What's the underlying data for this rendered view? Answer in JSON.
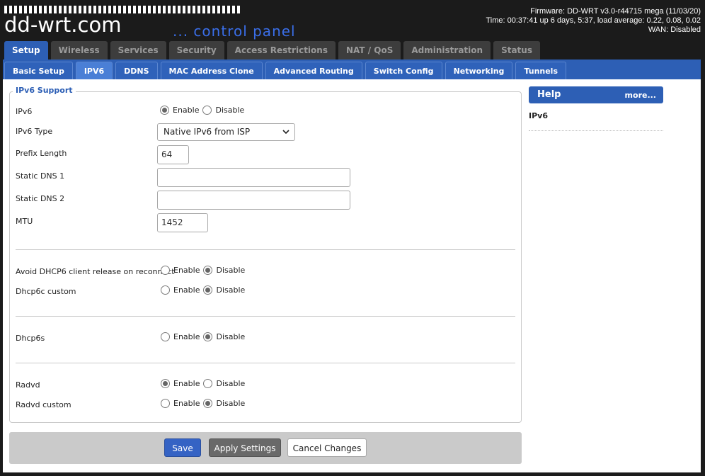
{
  "header": {
    "logo_text": "dd-wrt.com",
    "tagline": "... control panel",
    "firmware": "Firmware: DD-WRT v3.0-r44715 mega (11/03/20)",
    "time": "Time: 00:37:41 up 6 days, 5:37, load average: 0.22, 0.08, 0.02",
    "wan": "WAN: Disabled"
  },
  "main_tabs": [
    "Setup",
    "Wireless",
    "Services",
    "Security",
    "Access Restrictions",
    "NAT / QoS",
    "Administration",
    "Status"
  ],
  "sub_tabs": [
    "Basic Setup",
    "IPV6",
    "DDNS",
    "MAC Address Clone",
    "Advanced Routing",
    "Switch Config",
    "Networking",
    "Tunnels"
  ],
  "section": {
    "legend": "IPv6 Support",
    "enable_label": "Enable",
    "disable_label": "Disable",
    "ipv6_label": "IPv6",
    "ipv6_type_label": "IPv6 Type",
    "ipv6_type_value": "Native IPv6 from ISP",
    "prefix_length_label": "Prefix Length",
    "prefix_length_value": "64",
    "static_dns1_label": "Static DNS 1",
    "static_dns1_value": "",
    "static_dns2_label": "Static DNS 2",
    "static_dns2_value": "",
    "mtu_label": "MTU",
    "mtu_value": "1452",
    "avoid_dhcp6_label": "Avoid DHCP6 client release on reconnect",
    "dhcp6c_custom_label": "Dhcp6c custom",
    "dhcp6s_label": "Dhcp6s",
    "radvd_label": "Radvd",
    "radvd_custom_label": "Radvd custom"
  },
  "buttons": {
    "save": "Save",
    "apply": "Apply Settings",
    "cancel": "Cancel Changes"
  },
  "help": {
    "title": "Help",
    "more": "more...",
    "item": "IPv6"
  }
}
